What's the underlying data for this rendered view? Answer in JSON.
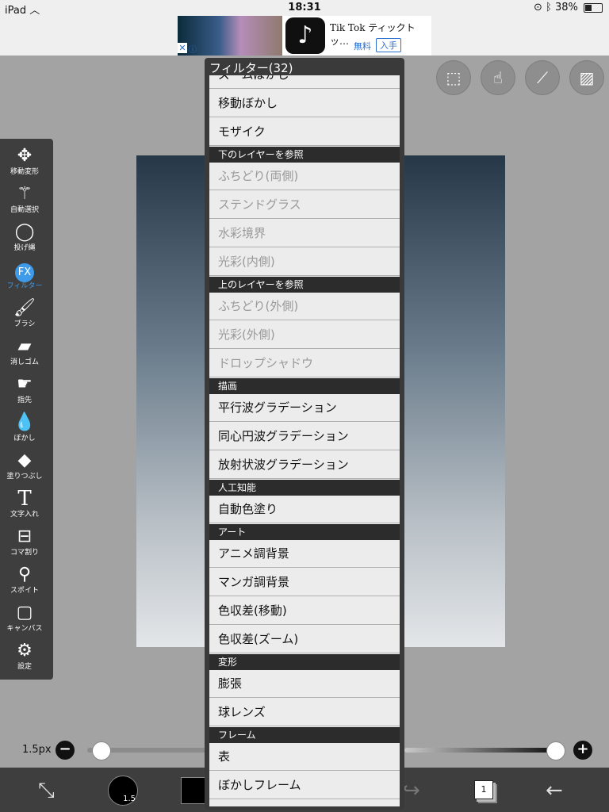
{
  "status_bar": {
    "device": "iPad",
    "time": "18:31",
    "battery": "38%"
  },
  "ad": {
    "title": "Tik Tok ティックトッ…",
    "free": "無料",
    "get_button": "入手",
    "close": "✕",
    "info": "ⓘ"
  },
  "top_icons": [
    "selection-icon",
    "hand-icon",
    "ruler-icon",
    "image-icon"
  ],
  "toolbar": {
    "items": [
      {
        "label": "移動変形",
        "icon": "move-icon"
      },
      {
        "label": "自動選択",
        "icon": "magic-wand-icon"
      },
      {
        "label": "投げ縄",
        "icon": "lasso-icon"
      },
      {
        "label": "フィルター",
        "icon": "fx-icon",
        "active": true
      },
      {
        "label": "ブラシ",
        "icon": "brush-icon"
      },
      {
        "label": "消しゴム",
        "icon": "eraser-icon"
      },
      {
        "label": "指先",
        "icon": "finger-icon"
      },
      {
        "label": "ぼかし",
        "icon": "blur-drop-icon"
      },
      {
        "label": "塗りつぶし",
        "icon": "fill-icon"
      },
      {
        "label": "文字入れ",
        "icon": "text-icon"
      },
      {
        "label": "コマ割り",
        "icon": "frame-divider-icon"
      },
      {
        "label": "スポイト",
        "icon": "eyedropper-icon"
      },
      {
        "label": "キャンバス",
        "icon": "canvas-icon"
      },
      {
        "label": "設定",
        "icon": "gear-icon"
      }
    ],
    "fx_text": "FX",
    "text_tool_glyph": "T"
  },
  "brush": {
    "size_label": "1.5px",
    "brush_circle_value": "1.5",
    "minus": "−",
    "plus": "+"
  },
  "layers": {
    "count": "1"
  },
  "filter_panel": {
    "title": "フィルター(32)",
    "rows": [
      {
        "type": "item",
        "label": "ズームぼかし",
        "enabled": true
      },
      {
        "type": "item",
        "label": "移動ぼかし",
        "enabled": true
      },
      {
        "type": "item",
        "label": "モザイク",
        "enabled": true
      },
      {
        "type": "section",
        "label": "下のレイヤーを参照"
      },
      {
        "type": "item",
        "label": "ふちどり(両側)",
        "enabled": false
      },
      {
        "type": "item",
        "label": "ステンドグラス",
        "enabled": false
      },
      {
        "type": "item",
        "label": "水彩境界",
        "enabled": false
      },
      {
        "type": "item",
        "label": "光彩(内側)",
        "enabled": false
      },
      {
        "type": "section",
        "label": "上のレイヤーを参照"
      },
      {
        "type": "item",
        "label": "ふちどり(外側)",
        "enabled": false
      },
      {
        "type": "item",
        "label": "光彩(外側)",
        "enabled": false
      },
      {
        "type": "item",
        "label": "ドロップシャドウ",
        "enabled": false
      },
      {
        "type": "section",
        "label": "描画"
      },
      {
        "type": "item",
        "label": "平行波グラデーション",
        "enabled": true
      },
      {
        "type": "item",
        "label": "同心円波グラデーション",
        "enabled": true
      },
      {
        "type": "item",
        "label": "放射状波グラデーション",
        "enabled": true
      },
      {
        "type": "section",
        "label": "人工知能"
      },
      {
        "type": "item",
        "label": "自動色塗り",
        "enabled": true
      },
      {
        "type": "section",
        "label": "アート"
      },
      {
        "type": "item",
        "label": "アニメ調背景",
        "enabled": true
      },
      {
        "type": "item",
        "label": "マンガ調背景",
        "enabled": true
      },
      {
        "type": "item",
        "label": "色収差(移動)",
        "enabled": true
      },
      {
        "type": "item",
        "label": "色収差(ズーム)",
        "enabled": true
      },
      {
        "type": "section",
        "label": "変形"
      },
      {
        "type": "item",
        "label": "膨張",
        "enabled": true
      },
      {
        "type": "item",
        "label": "球レンズ",
        "enabled": true
      },
      {
        "type": "section",
        "label": "フレーム"
      },
      {
        "type": "item",
        "label": "表",
        "enabled": true
      },
      {
        "type": "item",
        "label": "ぼかしフレーム",
        "enabled": true
      }
    ]
  }
}
